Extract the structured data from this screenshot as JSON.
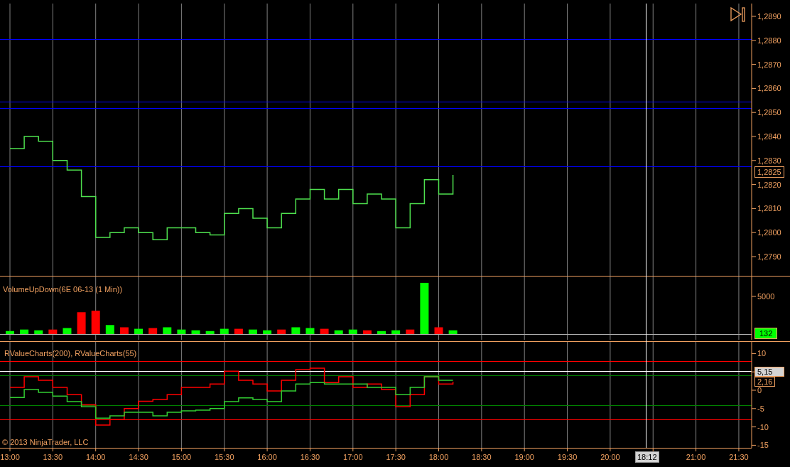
{
  "price_panel": {
    "axis_labels": [
      "1,2890",
      "1,2880",
      "1,2870",
      "1,2860",
      "1,2850",
      "1,2840",
      "1,2830",
      "1,2820",
      "1,2810",
      "1,2800",
      "1,2790"
    ],
    "price_marker": "1,2825"
  },
  "volume_panel": {
    "title": "VolumeUpDown(6E 06-13 (1 Min))",
    "axis_labels": [
      "5000"
    ],
    "value_marker": "132"
  },
  "rvalue_panel": {
    "title": "RValueCharts(200), RValueCharts(55)",
    "axis_labels": [
      "10",
      "0",
      "-5",
      "-10",
      "-15"
    ],
    "value_markers": [
      {
        "text": "5,15",
        "kind": "filled"
      },
      {
        "text": "2,16",
        "kind": "outlined"
      }
    ]
  },
  "time_axis": {
    "labels": [
      "13:00",
      "13:30",
      "14:00",
      "14:30",
      "15:00",
      "15:30",
      "16:00",
      "16:30",
      "17:00",
      "17:30",
      "18:00",
      "18:30",
      "19:00",
      "19:30",
      "20:00",
      "21:00",
      "21:30"
    ],
    "cursor_label": "18:12"
  },
  "copyright": "© 2013 NinjaTrader, LLC"
}
